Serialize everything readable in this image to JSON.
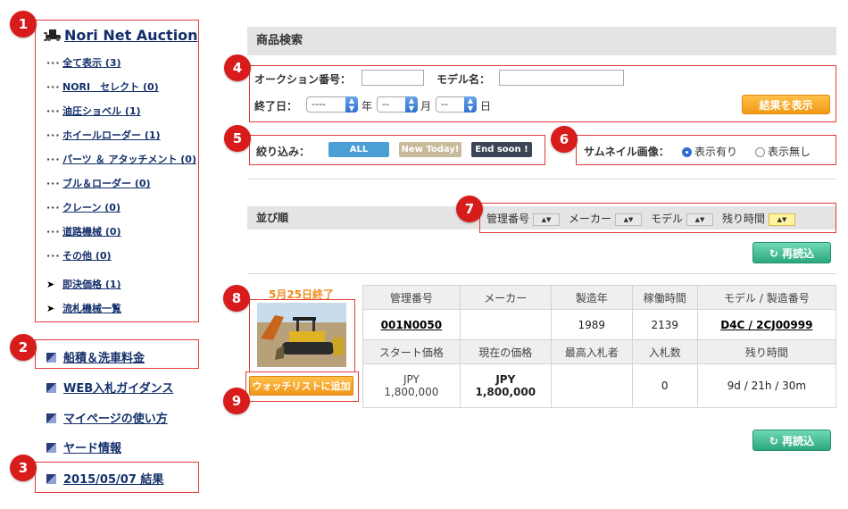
{
  "sidebar": {
    "title": "Nori Net Auction",
    "categories": [
      {
        "label": "全て表示 (3)"
      },
      {
        "label": "NORI　セレクト (0)"
      },
      {
        "label": "油圧ショベル (1)"
      },
      {
        "label": "ホイールローダー (1)"
      },
      {
        "label": "パーツ ＆ アタッチメント (0)"
      },
      {
        "label": "ブル＆ローダー (0)"
      },
      {
        "label": "クレーン (0)"
      },
      {
        "label": "道路機械 (0)"
      },
      {
        "label": "その他 (0)"
      }
    ],
    "arrow_links": [
      {
        "label": "即決価格 (1)"
      },
      {
        "label": "流札機械一覧"
      }
    ],
    "links": [
      {
        "label": "船積＆洗車料金"
      },
      {
        "label": "WEB入札ガイダンス"
      },
      {
        "label": "マイページの使い方"
      },
      {
        "label": "ヤード情報"
      },
      {
        "label": "2015/05/07 結果"
      }
    ]
  },
  "badges": [
    "1",
    "2",
    "3",
    "4",
    "5",
    "6",
    "7",
    "8",
    "9"
  ],
  "search": {
    "header": "商品検索",
    "auction_no_label": "オークション番号：",
    "model_label": "モデル名：",
    "end_date_label": "終了日：",
    "year_value": "----",
    "year_unit": "年",
    "month_value": "--",
    "month_unit": "月",
    "day_value": "--",
    "day_unit": "日",
    "submit_label": "結果を表示"
  },
  "filter": {
    "label": "絞り込み：",
    "all": "ALL",
    "new_today": "New Today!",
    "end_soon": "End soon !"
  },
  "thumbnail": {
    "label": "サムネイル画像：",
    "option_on": "表示有り",
    "option_off": "表示無し",
    "selected": "on"
  },
  "sort": {
    "label": "並び順",
    "keys": [
      "管理番号",
      "メーカー",
      "モデル",
      "残り時間"
    ],
    "reload": "再読込"
  },
  "listing": {
    "end_date": "5月25日終了",
    "watch_label": "ウォッチリストに追加",
    "headers1": [
      "管理番号",
      "メーカー",
      "製造年",
      "稼働時間",
      "モデル / 製造番号"
    ],
    "values1": [
      "001N0050",
      "",
      "1989",
      "2139",
      "D4C / 2CJ00999"
    ],
    "headers2": [
      "スタート価格",
      "現在の価格",
      "最高入札者",
      "入札数",
      "残り時間"
    ],
    "start_price": "JPY\n1,800,000",
    "current_price": "JPY\n1,800,000",
    "top_bidder": "",
    "bids": "0",
    "remaining": "9d / 21h / 30m"
  },
  "colors": {
    "badge": "#d81c1c",
    "highlight_box": "#e23b3b",
    "link": "#14306b",
    "all_pill": "#4a9fd4",
    "new_today_pill": "#c8bb9a",
    "end_soon_pill": "#3c4556",
    "orange_button": "#f5a623",
    "green_button": "#3cbf8f",
    "end_date_text": "#f08c1e"
  }
}
